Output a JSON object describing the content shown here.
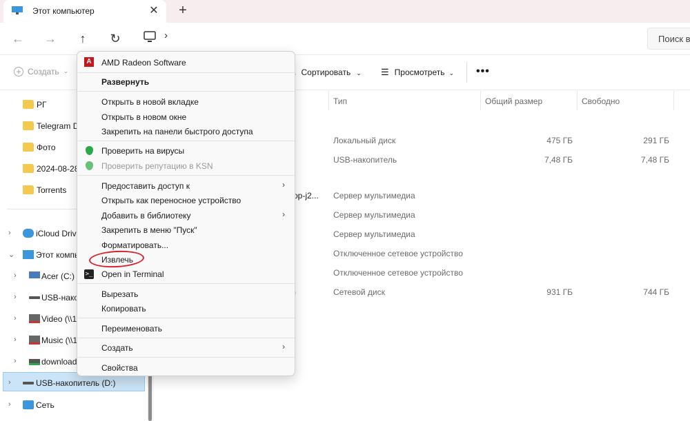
{
  "window": {
    "tab_title": "Этот компьютер",
    "close_glyph": "✕",
    "new_tab_glyph": "+"
  },
  "nav": {
    "back": "←",
    "forward": "→",
    "up": "↑",
    "refresh": "↻",
    "breadcrumb_chevron": "›",
    "search_placeholder": "Поиск в"
  },
  "toolbar": {
    "create": "Создать",
    "sort": "Сортировать",
    "view": "Просмотреть",
    "more": "•••"
  },
  "sidebar": {
    "quick_items": [
      {
        "label": "PГ"
      },
      {
        "label": "Telegram De"
      },
      {
        "label": "Фото"
      },
      {
        "label": "2024-08-28"
      },
      {
        "label": "Torrents"
      }
    ],
    "tree": [
      {
        "label": "iCloud Drive",
        "chev": "›"
      },
      {
        "label": "Этот компью",
        "chev": "⌄"
      },
      {
        "label": "Acer (C:)",
        "chev": "›"
      },
      {
        "label": "USB-нако",
        "chev": "›"
      },
      {
        "label": "Video (\\\\1",
        "chev": "›"
      },
      {
        "label": "Music (\\\\1",
        "chev": "›"
      },
      {
        "label": "download",
        "chev": "›"
      },
      {
        "label": "USB-накопитель (D:)",
        "chev": "›"
      },
      {
        "label": "Сеть",
        "chev": "›"
      }
    ]
  },
  "columns": {
    "type": "Тип",
    "total": "Общий размер",
    "free": "Свободно"
  },
  "rows": [
    {
      "name": "",
      "type": "Локальный диск",
      "total": "475 ГБ",
      "free": "291 ГБ"
    },
    {
      "name": "",
      "type": "USB-накопитель",
      "total": "7,48 ГБ",
      "free": "7,48 ГБ"
    },
    {
      "name": "op-j2...",
      "type": "Сервер мультимедиа",
      "total": "",
      "free": ""
    },
    {
      "name": "",
      "type": "Сервер мультимедиа",
      "total": "",
      "free": ""
    },
    {
      "name": "",
      "type": "Сервер мультимедиа",
      "total": "",
      "free": ""
    },
    {
      "name": "",
      "type": "Отключенное сетевое устройство",
      "total": "",
      "free": ""
    },
    {
      "name": "",
      "type": "Отключенное сетевое устройство",
      "total": "",
      "free": ""
    },
    {
      "name": ")",
      "type": "Сетевой диск",
      "total": "931 ГБ",
      "free": "744 ГБ"
    }
  ],
  "menu": {
    "amd": "AMD Radeon Software",
    "expand": "Развернуть",
    "open_new_tab": "Открыть в новой вкладке",
    "open_new_window": "Открыть в новом окне",
    "pin_quick": "Закрепить на панели быстрого доступа",
    "scan": "Проверить на вирусы",
    "ksn": "Проверить репутацию в KSN",
    "share": "Предоставить доступ к",
    "portable": "Открыть как переносное устройство",
    "library": "Добавить в библиотеку",
    "pin_start": "Закрепить в меню \"Пуск\"",
    "format": "Форматировать...",
    "eject": "Извлечь",
    "terminal": "Open in Terminal",
    "cut": "Вырезать",
    "copy": "Копировать",
    "rename": "Переименовать",
    "create": "Создать",
    "properties": "Свойства",
    "arrow": "›",
    "amd_glyph": "A",
    "term_glyph": ">_"
  },
  "colors": {
    "accent": "#0067c0",
    "annotation": "#d9262e",
    "selection": "#cce4f7"
  }
}
